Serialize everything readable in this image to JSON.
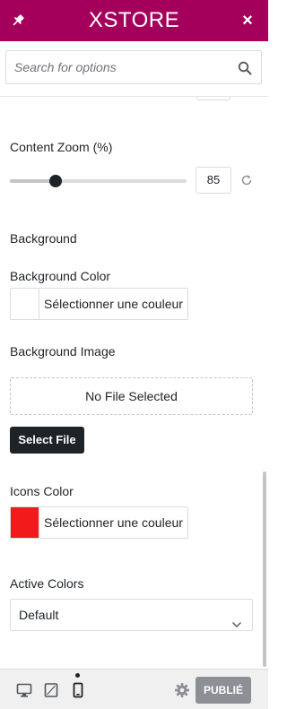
{
  "header": {
    "logo_text": "XSTORE",
    "close_symbol": "×"
  },
  "search": {
    "placeholder": "Search for options"
  },
  "content_zoom": {
    "label": "Content Zoom (%)",
    "value": "85",
    "percent_of_range": 0.26
  },
  "background": {
    "section_title": "Background",
    "color_label": "Background Color",
    "color_picker_text": "Sélectionner une couleur",
    "color_value": "#ffffff",
    "image_label": "Background Image",
    "no_file_text": "No File Selected",
    "select_file_label": "Select File"
  },
  "icons_color": {
    "label": "Icons Color",
    "color_picker_text": "Sélectionner une couleur",
    "color_value": "#f11b1b"
  },
  "active_colors": {
    "label": "Active Colors",
    "selected": "Default"
  },
  "footer": {
    "devices": [
      "desktop-icon",
      "tablet-icon",
      "mobile-icon"
    ],
    "active_device": "mobile",
    "publish_label": "PUBLIÉ"
  },
  "colors": {
    "brand": "#a4005b",
    "publish_disabled": "#8c8f94"
  }
}
